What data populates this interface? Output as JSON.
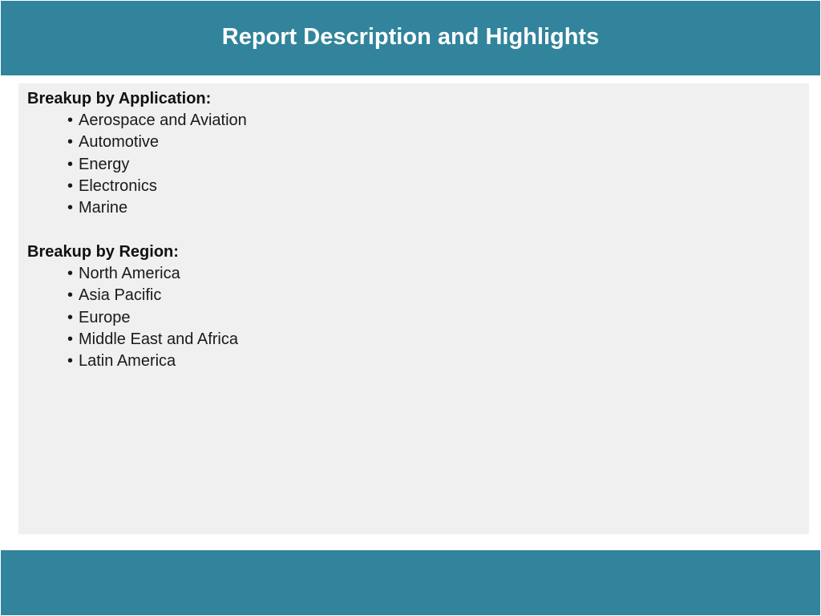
{
  "header": {
    "title": "Report Description and Highlights"
  },
  "sections": [
    {
      "heading": "Breakup by Application:",
      "items": [
        "Aerospace and Aviation",
        "Automotive",
        "Energy",
        "Electronics",
        "Marine"
      ]
    },
    {
      "heading": "Breakup by Region:",
      "items": [
        "North America",
        "Asia Pacific",
        "Europe",
        "Middle East and Africa",
        "Latin America"
      ]
    }
  ],
  "bullet_char": "•",
  "colors": {
    "header_bg": "#31849b",
    "footer_bg": "#31849b",
    "panel_bg": "#f0f0f0",
    "title_text": "#ffffff"
  }
}
